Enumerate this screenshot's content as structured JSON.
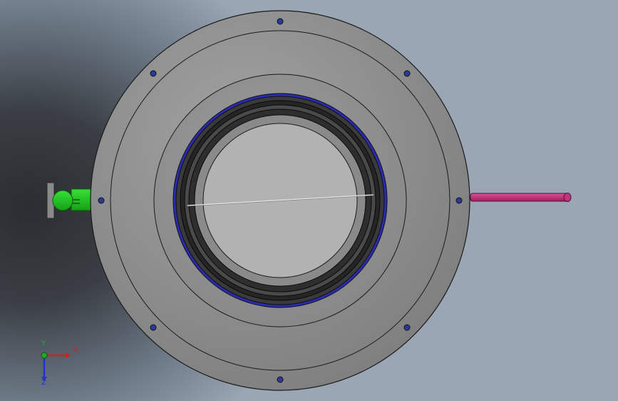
{
  "viewport": {
    "background": "gradient-gray-blue"
  },
  "model": {
    "part": "butterfly valve",
    "view": "front",
    "colors": {
      "body": "#8e8e8e",
      "flange_face": "#9a9a9a",
      "seal_ring": "#2b2bb0",
      "bore": "#b2b2b2",
      "actuator_shaft": "#22cc22",
      "stem_pin": "#c0307a",
      "edge": "#1a1a1a"
    },
    "bolt_hole_count": 8
  },
  "triad": {
    "x_label": "X",
    "y_label": "Y",
    "z_label": "Z",
    "x_color": "#cc2222",
    "y_color": "#22aa22",
    "z_color": "#2233cc"
  }
}
